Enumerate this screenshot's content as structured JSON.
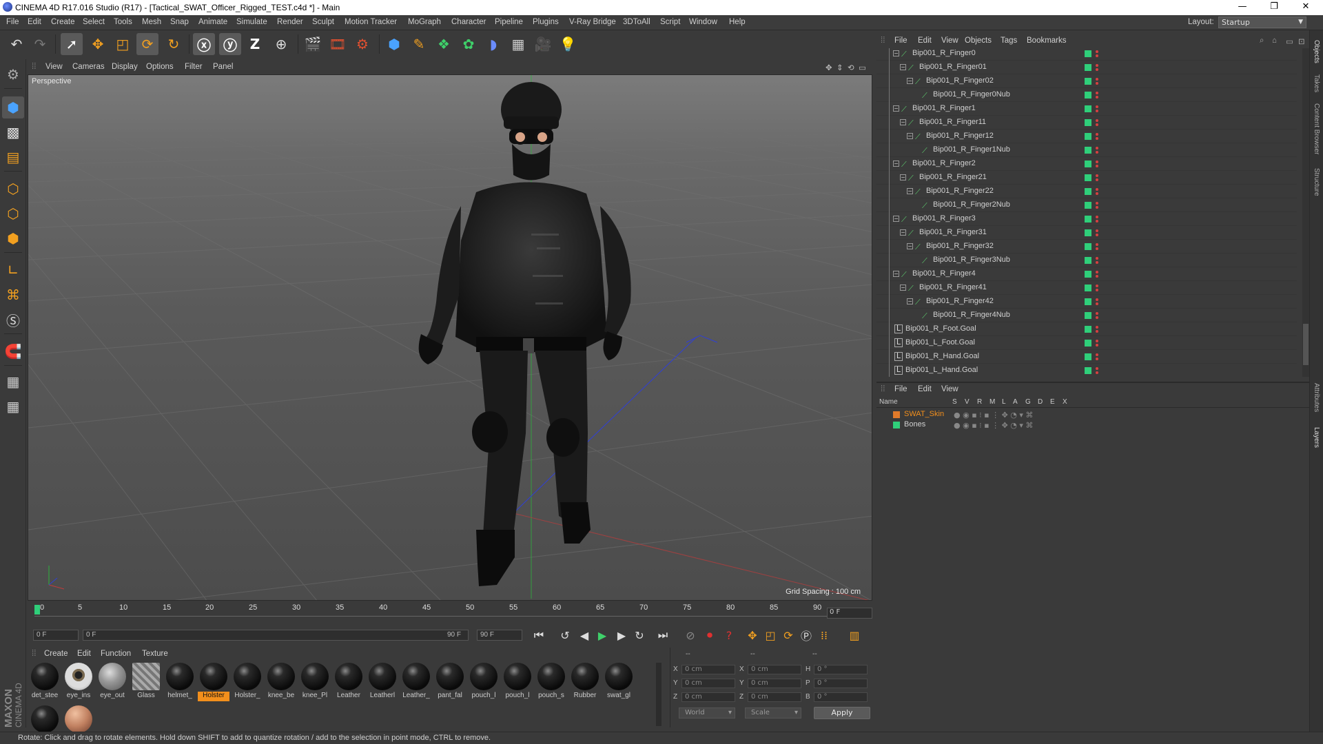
{
  "window": {
    "title": "CINEMA 4D R17.016 Studio (R17) - [Tactical_SWAT_Officer_Rigged_TEST.c4d *] - Main",
    "min": "—",
    "max": "❐",
    "close": "✕"
  },
  "menu": [
    "File",
    "Edit",
    "Create",
    "Select",
    "Tools",
    "Mesh",
    "Snap",
    "Animate",
    "Simulate",
    "Render",
    "Sculpt",
    "Motion Tracker",
    "MoGraph",
    "Character",
    "Pipeline",
    "Plugins",
    "V-Ray Bridge",
    "3DToAll",
    "Script",
    "Window",
    "Help"
  ],
  "layout": {
    "label": "Layout:",
    "value": "Startup"
  },
  "viewport": {
    "menu": [
      "View",
      "Cameras",
      "Display",
      "Options",
      "Filter",
      "Panel"
    ],
    "label": "Perspective",
    "grid_spacing": "Grid Spacing : 100 cm"
  },
  "timeline": {
    "ticks": [
      "0",
      "5",
      "10",
      "15",
      "20",
      "25",
      "30",
      "35",
      "40",
      "45",
      "50",
      "55",
      "60",
      "65",
      "70",
      "75",
      "80",
      "85",
      "90"
    ],
    "frame_field": "0 F",
    "start": "0 F",
    "range_start": "0 F",
    "range_end": "90 F",
    "end": "90 F"
  },
  "materials": {
    "menu": [
      "Create",
      "Edit",
      "Function",
      "Texture"
    ],
    "items": [
      {
        "label": "det_stee",
        "kind": "dark"
      },
      {
        "label": "eye_ins",
        "kind": "eye"
      },
      {
        "label": "eye_out",
        "kind": "glass"
      },
      {
        "label": "Glass",
        "kind": "stripe"
      },
      {
        "label": "helmet_",
        "kind": "dark"
      },
      {
        "label": "Holster",
        "kind": "dark",
        "selected": true
      },
      {
        "label": "Holster_",
        "kind": "dark"
      },
      {
        "label": "knee_be",
        "kind": "dark"
      },
      {
        "label": "knee_Pl",
        "kind": "dark"
      },
      {
        "label": "Leather",
        "kind": "dark"
      },
      {
        "label": "Leatherl",
        "kind": "dark"
      },
      {
        "label": "Leather_",
        "kind": "dark"
      },
      {
        "label": "pant_fal",
        "kind": "dark"
      },
      {
        "label": "pouch_l",
        "kind": "dark"
      },
      {
        "label": "pouch_l",
        "kind": "dark"
      },
      {
        "label": "pouch_s",
        "kind": "dark"
      },
      {
        "label": "Rubber",
        "kind": "dark"
      },
      {
        "label": "swat_gl",
        "kind": "dark"
      },
      {
        "label": "",
        "kind": "dark"
      },
      {
        "label": "",
        "kind": "skin"
      }
    ]
  },
  "coords": {
    "headers": [
      "--",
      "--",
      "--"
    ],
    "rows": [
      {
        "a": "X",
        "av": "0 cm",
        "b": "X",
        "bv": "0 cm",
        "c": "H",
        "cv": "0 °"
      },
      {
        "a": "Y",
        "av": "0 cm",
        "b": "Y",
        "bv": "0 cm",
        "c": "P",
        "cv": "0 °"
      },
      {
        "a": "Z",
        "av": "0 cm",
        "b": "Z",
        "bv": "0 cm",
        "c": "B",
        "cv": "0 °"
      }
    ],
    "world": "World",
    "scale": "Scale",
    "apply": "Apply"
  },
  "status": "Rotate: Click and drag to rotate elements. Hold down SHIFT to add to quantize rotation / add to the selection in point mode, CTRL to remove.",
  "object_manager": {
    "menu": [
      "File",
      "Edit",
      "View",
      "Objects",
      "Tags",
      "Bookmarks"
    ],
    "rows": [
      {
        "name": "Bip001_R_Finger0",
        "depth": 1,
        "type": "bone",
        "exp": true
      },
      {
        "name": "Bip001_R_Finger01",
        "depth": 2,
        "type": "bone",
        "exp": true
      },
      {
        "name": "Bip001_R_Finger02",
        "depth": 3,
        "type": "bone",
        "exp": true
      },
      {
        "name": "Bip001_R_Finger0Nub",
        "depth": 4,
        "type": "bone",
        "exp": false
      },
      {
        "name": "Bip001_R_Finger1",
        "depth": 1,
        "type": "bone",
        "exp": true
      },
      {
        "name": "Bip001_R_Finger11",
        "depth": 2,
        "type": "bone",
        "exp": true
      },
      {
        "name": "Bip001_R_Finger12",
        "depth": 3,
        "type": "bone",
        "exp": true
      },
      {
        "name": "Bip001_R_Finger1Nub",
        "depth": 4,
        "type": "bone",
        "exp": false
      },
      {
        "name": "Bip001_R_Finger2",
        "depth": 1,
        "type": "bone",
        "exp": true
      },
      {
        "name": "Bip001_R_Finger21",
        "depth": 2,
        "type": "bone",
        "exp": true
      },
      {
        "name": "Bip001_R_Finger22",
        "depth": 3,
        "type": "bone",
        "exp": true
      },
      {
        "name": "Bip001_R_Finger2Nub",
        "depth": 4,
        "type": "bone",
        "exp": false
      },
      {
        "name": "Bip001_R_Finger3",
        "depth": 1,
        "type": "bone",
        "exp": true
      },
      {
        "name": "Bip001_R_Finger31",
        "depth": 2,
        "type": "bone",
        "exp": true
      },
      {
        "name": "Bip001_R_Finger32",
        "depth": 3,
        "type": "bone",
        "exp": true
      },
      {
        "name": "Bip001_R_Finger3Nub",
        "depth": 4,
        "type": "bone",
        "exp": false
      },
      {
        "name": "Bip001_R_Finger4",
        "depth": 1,
        "type": "bone",
        "exp": true
      },
      {
        "name": "Bip001_R_Finger41",
        "depth": 2,
        "type": "bone",
        "exp": true
      },
      {
        "name": "Bip001_R_Finger42",
        "depth": 3,
        "type": "bone",
        "exp": true
      },
      {
        "name": "Bip001_R_Finger4Nub",
        "depth": 4,
        "type": "bone",
        "exp": false
      },
      {
        "name": "Bip001_R_Foot.Goal",
        "depth": 0,
        "type": "goal",
        "exp": false
      },
      {
        "name": "Bip001_L_Foot.Goal",
        "depth": 0,
        "type": "goal",
        "exp": false
      },
      {
        "name": "Bip001_R_Hand.Goal",
        "depth": 0,
        "type": "goal",
        "exp": false
      },
      {
        "name": "Bip001_L_Hand.Goal",
        "depth": 0,
        "type": "goal",
        "exp": false
      }
    ]
  },
  "layers": {
    "menu": [
      "File",
      "Edit",
      "View"
    ],
    "columns": [
      "Name",
      "S",
      "V",
      "R",
      "M",
      "L",
      "A",
      "G",
      "D",
      "E",
      "X"
    ],
    "rows": [
      {
        "name": "SWAT_Skin",
        "color": "#e07a2a",
        "text_color": "#f28f1c"
      },
      {
        "name": "Bones",
        "color": "#2fcf7a",
        "text_color": "#d0d0d0"
      }
    ]
  },
  "side_tabs": [
    "Objects",
    "Takes",
    "Content Browser",
    "Structure",
    "Attributes",
    "Layers"
  ],
  "brand": {
    "line1": "MAXON",
    "line2": "CINEMA 4D"
  }
}
